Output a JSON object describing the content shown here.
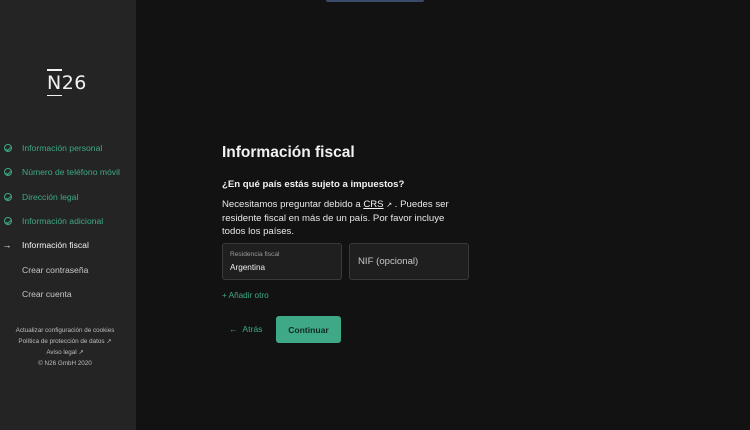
{
  "brand": {
    "logo_n": "N",
    "logo_rest": "26"
  },
  "steps": [
    {
      "label": "Información personal",
      "state": "done"
    },
    {
      "label": "Número de teléfono móvil",
      "state": "done"
    },
    {
      "label": "Dirección legal",
      "state": "done"
    },
    {
      "label": "Información adicional",
      "state": "done"
    },
    {
      "label": "Información fiscal",
      "state": "current",
      "marker": "→"
    },
    {
      "label": "Crear contraseña",
      "state": "todo"
    },
    {
      "label": "Crear cuenta",
      "state": "todo"
    }
  ],
  "footer": {
    "cookies": "Actualizar configuración de cookies",
    "privacy": "Política de protección de datos ↗",
    "legal": "Aviso legal ↗",
    "copyright": "© N26 GmbH 2020"
  },
  "form": {
    "title": "Información fiscal",
    "question": "¿En qué país estás sujeto a impuestos?",
    "desc_before": "Necesitamos preguntar debido a ",
    "desc_link": "CRS",
    "desc_link_icon": "↗",
    "desc_after": " . Puedes ser residente fiscal en más de un país. Por favor incluye todos los países.",
    "residence_label": "Residencia fiscal",
    "residence_value": "Argentina",
    "nif_placeholder": "NIF (opcional)",
    "add_other": "+ Añadir otro",
    "back_arrow": "←",
    "back_label": "Atrás",
    "continue_label": "Continuar"
  },
  "colors": {
    "accent": "#3fa887",
    "sidebar": "#242424",
    "background": "#121212"
  }
}
